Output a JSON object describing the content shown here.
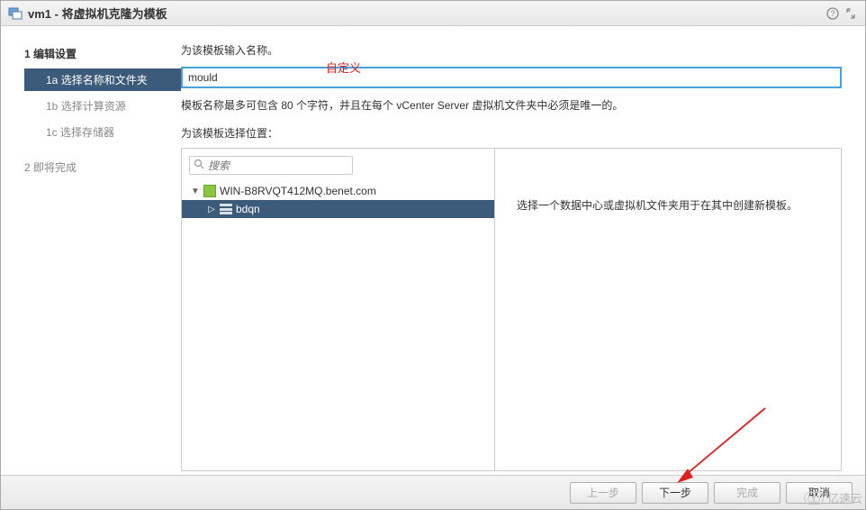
{
  "title": "vm1 - 将虚拟机克隆为模板",
  "sidebar": {
    "step1": {
      "num": "1",
      "label": "编辑设置"
    },
    "step1a": {
      "num": "1a",
      "label": "选择名称和文件夹"
    },
    "step1b": {
      "num": "1b",
      "label": "选择计算资源"
    },
    "step1c": {
      "num": "1c",
      "label": "选择存储器"
    },
    "step2": {
      "num": "2",
      "label": "即将完成"
    }
  },
  "main": {
    "prompt": "为该模板输入名称。",
    "name_value": "mould",
    "custom_annot": "自定义",
    "hint": "模板名称最多可包含 80 个字符，并且在每个 vCenter Server 虚拟机文件夹中必须是唯一的。",
    "location_label": "为该模板选择位置：",
    "search_placeholder": "搜索",
    "tree": {
      "root": "WIN-B8RVQT412MQ.benet.com",
      "dc": "bdqn"
    },
    "help_text": "选择一个数据中心或虚拟机文件夹用于在其中创建新模板。"
  },
  "footer": {
    "back": "上一步",
    "next": "下一步",
    "finish": "完成",
    "cancel": "取消"
  },
  "watermark": "亿速云"
}
